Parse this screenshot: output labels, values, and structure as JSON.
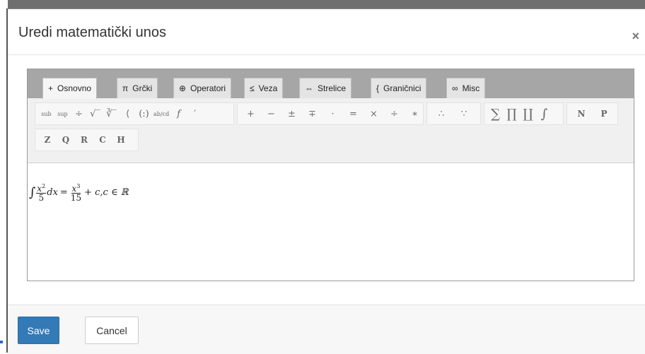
{
  "dialog": {
    "title": "Uredi matematički unos",
    "close_glyph": "×"
  },
  "tabs": [
    {
      "icon": "+",
      "label": "Osnovno",
      "active": true
    },
    {
      "icon": "π",
      "label": "Grčki"
    },
    {
      "icon": "⊕",
      "label": "Operatori"
    },
    {
      "icon": "≤",
      "label": "Veza"
    },
    {
      "icon": "⇔",
      "label": "Strelice"
    },
    {
      "icon": "{",
      "label": "Graničnici"
    },
    {
      "icon": "∞",
      "label": "Misc"
    }
  ],
  "symbols": {
    "group1": [
      "sub",
      "sup",
      "÷",
      "√‾",
      "∛‾",
      "⟨",
      "(:)",
      "ab/cd",
      "f",
      "′"
    ],
    "group2": [
      "+",
      "−",
      "±",
      "∓",
      "·",
      "=",
      "×",
      "÷",
      "∗"
    ],
    "group3": [
      "∴",
      "∵"
    ],
    "group4": [
      "∑",
      "∏",
      "∐",
      "∫"
    ],
    "group5": [
      "N",
      "P"
    ],
    "group6": [
      "Z",
      "Q",
      "R",
      "C",
      "H"
    ]
  },
  "formula": {
    "integral": "∫",
    "frac1_num": "x",
    "frac1_exp": "2",
    "frac1_den": "5",
    "dx": "dx",
    "eq": "=",
    "frac2_num": "x",
    "frac2_exp": "3",
    "frac2_den": "15",
    "rest": "+ c,c ∈ ℝ"
  },
  "footer": {
    "save_label": "Save",
    "cancel_label": "Cancel"
  },
  "colors": {
    "primary": "#337ab7",
    "tabstrip": "#a6a6a6"
  }
}
